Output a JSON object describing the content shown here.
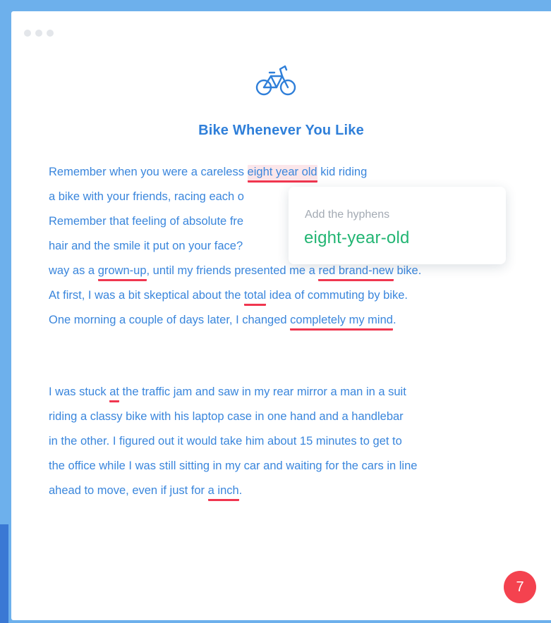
{
  "colors": {
    "frame": "#6db0ec",
    "frame_accent": "#3a78d4",
    "text": "#3a86dc",
    "title": "#2f7fd9",
    "error_underline": "#f0364f",
    "suggestion": "#22b573",
    "badge": "#f4424f"
  },
  "window": {
    "dots": [
      "",
      "",
      ""
    ]
  },
  "header": {
    "icon": "bike-icon",
    "title": "Bike Whenever You Like"
  },
  "paragraph1": {
    "l1_a": "Remember when you were a careless ",
    "l1_err": "eight year old",
    "l1_b": " kid riding",
    "l2": "a bike with your friends, racing each o",
    "l3": "Remember that feeling of absolute fre",
    "l4": "hair and the smile it put on your face?",
    "l5_a": "way as a ",
    "l5_err1": "grown-up",
    "l5_b": ", until my friends presented me a ",
    "l5_err2": "red brand-new",
    "l5_c": " bike.",
    "l6_a": "At first, I was a bit skeptical about the ",
    "l6_err": "total",
    "l6_b": " idea of commuting by bike.",
    "l7_a": "One morning a couple of days later, I changed ",
    "l7_err": "completely my mind",
    "l7_b": "."
  },
  "paragraph2": {
    "l1_a": "I was stuck ",
    "l1_err": "at",
    "l1_b": " the traffic jam and saw in my rear mirror a man in a suit",
    "l2": "riding a classy bike with his laptop case in one hand and a handlebar",
    "l3": "in the other. I figured out it would take him about 15 minutes to get to",
    "l4": "the office while I was still sitting in my car and waiting for the cars in line",
    "l5_a": "ahead to move, even if just for ",
    "l5_err": "a inch",
    "l5_b": "."
  },
  "tooltip": {
    "label": "Add the hyphens",
    "suggestion": "eight-year-old"
  },
  "badge": {
    "count": "7"
  }
}
